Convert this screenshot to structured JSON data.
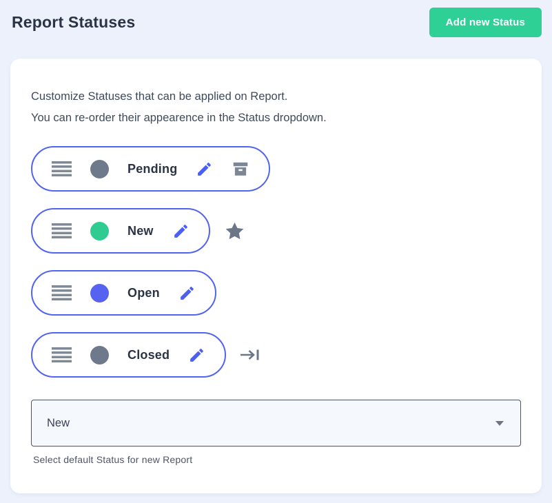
{
  "page": {
    "title": "Report Statuses",
    "add_button_label": "Add new Status"
  },
  "card": {
    "intro_line1": "Customize Statuses that can be applied on Report.",
    "intro_line2": "You can re-order their appearence in the Status dropdown.",
    "statuses": [
      {
        "label": "Pending",
        "dot_color": "#6e7a8c",
        "icons": [
          "drag-handle",
          "edit-pencil",
          "archive-box"
        ]
      },
      {
        "label": "New",
        "dot_color": "#2ecc90",
        "icons": [
          "drag-handle",
          "edit-pencil",
          "default-star"
        ]
      },
      {
        "label": "Open",
        "dot_color": "#5663f0",
        "icons": [
          "drag-handle",
          "edit-pencil"
        ]
      },
      {
        "label": "Closed",
        "dot_color": "#6e7a8c",
        "icons": [
          "drag-handle",
          "edit-pencil",
          "closing-arrow"
        ]
      }
    ],
    "default_select": {
      "value": "New",
      "caption": "Select default Status for new Report"
    }
  },
  "colors": {
    "page_background": "#edf1fb",
    "card_background": "#ffffff",
    "accent_green": "#2ed096",
    "pill_border_blue": "#5163f1",
    "pencil_blue": "#4c5ff5",
    "icon_gray": "#6b7787"
  }
}
